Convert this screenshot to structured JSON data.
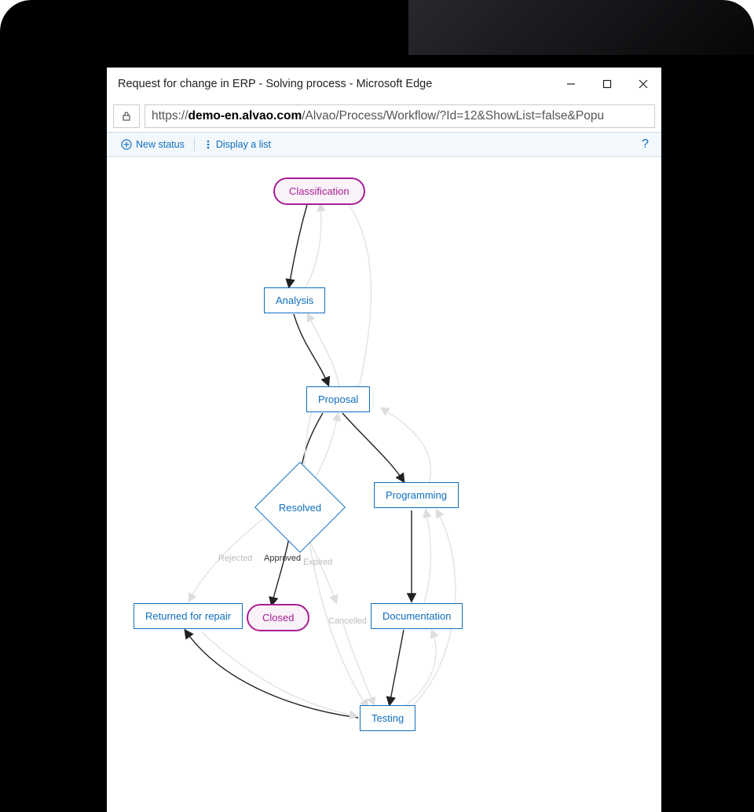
{
  "window": {
    "title": "Request for change in ERP - Solving process - Microsoft Edge"
  },
  "address": {
    "proto": "https://",
    "host": "demo-en.alvao.com",
    "path": "/Alvao/Process/Workflow/?Id=12&ShowList=false&Popu"
  },
  "toolbar": {
    "new_status": "New status",
    "display_list": "Display a list",
    "help": "?"
  },
  "nodes": {
    "classification": "Classification",
    "analysis": "Analysis",
    "proposal": "Proposal",
    "resolved": "Resolved",
    "programming": "Programming",
    "returned": "Returned for repair",
    "closed": "Closed",
    "documentation": "Documentation",
    "testing": "Testing"
  },
  "edge_labels": {
    "rejected": "Rejected",
    "approved": "Approved",
    "expired": "Expired",
    "cancelled": "Cancelled"
  }
}
